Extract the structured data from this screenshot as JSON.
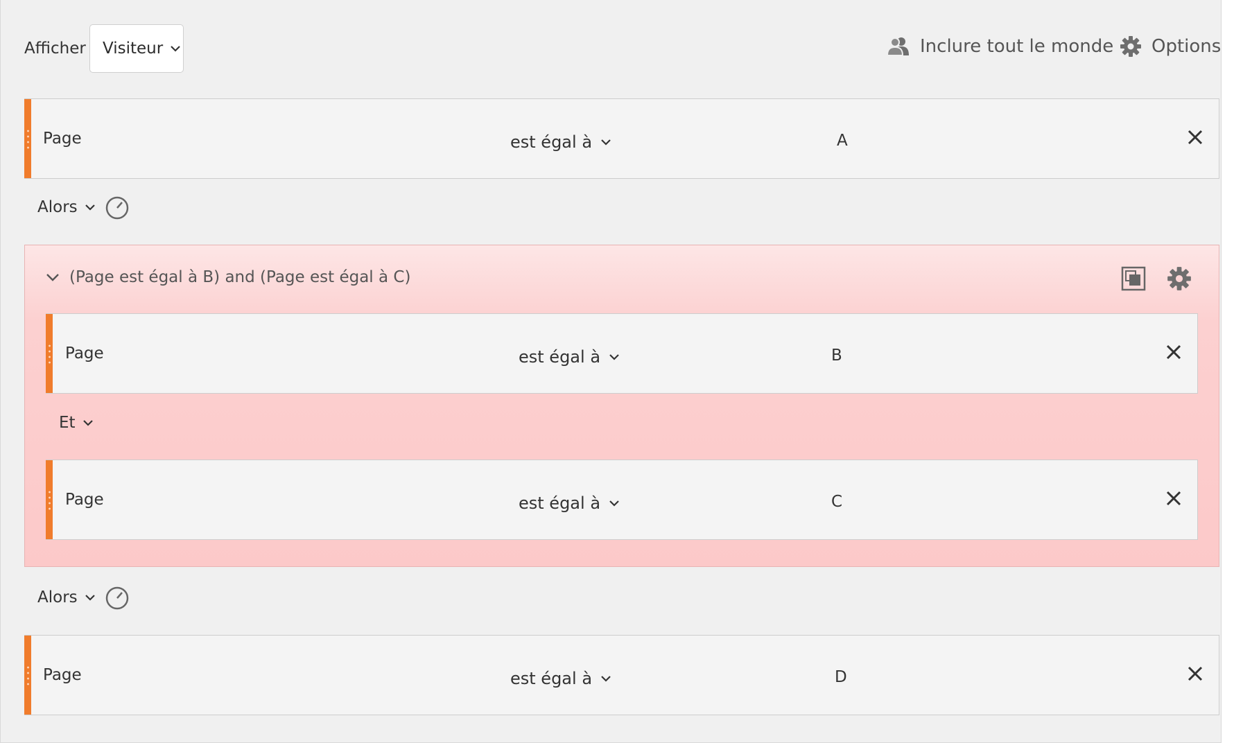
{
  "header": {
    "show_label": "Afficher",
    "show_select_value": "Visiteur",
    "include_all_label": "Inclure tout le monde",
    "options_label": "Options"
  },
  "rules": {
    "first": {
      "dimension": "Page",
      "operator": "est égal à",
      "value": "A"
    },
    "then_1": {
      "label": "Alors"
    },
    "container": {
      "title": "(Page est égal à B) and (Page est égal à C)",
      "rule_b": {
        "dimension": "Page",
        "operator": "est égal à",
        "value": "B"
      },
      "connector": {
        "label": "Et"
      },
      "rule_c": {
        "dimension": "Page",
        "operator": "est égal à",
        "value": "C"
      }
    },
    "then_2": {
      "label": "Alors"
    },
    "last": {
      "dimension": "Page",
      "operator": "est égal à",
      "value": "D"
    }
  },
  "colors": {
    "accent": "#f07c2c",
    "container_bg": "#fcc9c9",
    "canvas_bg": "#f0f0f0"
  },
  "icons": [
    "chevron-down-icon",
    "people-icon",
    "gear-icon",
    "clock-icon",
    "close-icon",
    "screen-icon"
  ]
}
